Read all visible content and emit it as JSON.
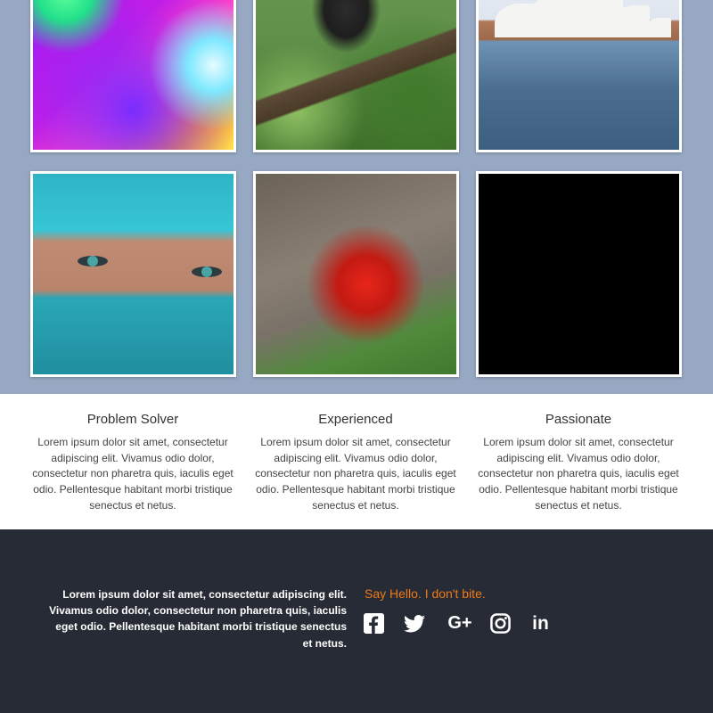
{
  "gallery": {
    "tiles": [
      {
        "alt": "colorful bokeh lights"
      },
      {
        "alt": "gorilla in forest"
      },
      {
        "alt": "sydney opera house"
      },
      {
        "alt": "face with turquoise scarf"
      },
      {
        "alt": "red racing motorcycle"
      },
      {
        "alt": "black image"
      }
    ]
  },
  "features": [
    {
      "title": "Problem Solver",
      "body": "Lorem ipsum dolor sit amet, consectetur adipiscing elit. Vivamus odio dolor, consectetur non pharetra quis, iaculis eget odio. Pellentesque habitant morbi tristique senectus et netus."
    },
    {
      "title": "Experienced",
      "body": "Lorem ipsum dolor sit amet, consectetur adipiscing elit. Vivamus odio dolor, consectetur non pharetra quis, iaculis eget odio. Pellentesque habitant morbi tristique senectus et netus."
    },
    {
      "title": "Passionate",
      "body": "Lorem ipsum dolor sit amet, consectetur adipiscing elit. Vivamus odio dolor, consectetur non pharetra quis, iaculis eget odio. Pellentesque habitant morbi tristique senectus et netus."
    }
  ],
  "footer": {
    "text": "Lorem ipsum dolor sit amet, consectetur adipiscing elit. Vivamus odio dolor, consectetur non pharetra quis, iaculis eget odio. Pellentesque habitant morbi tristique senectus et netus.",
    "say_hello": "Say Hello. I don't bite.",
    "social": {
      "gplus_label": "G+",
      "linkedin_label": "in",
      "icons": [
        "facebook-icon",
        "twitter-icon",
        "google-plus-icon",
        "instagram-icon",
        "linkedin-icon"
      ]
    }
  },
  "colors": {
    "gallery_bg": "#97a8c2",
    "footer_bg": "#262b35",
    "accent": "#ef7a16"
  }
}
